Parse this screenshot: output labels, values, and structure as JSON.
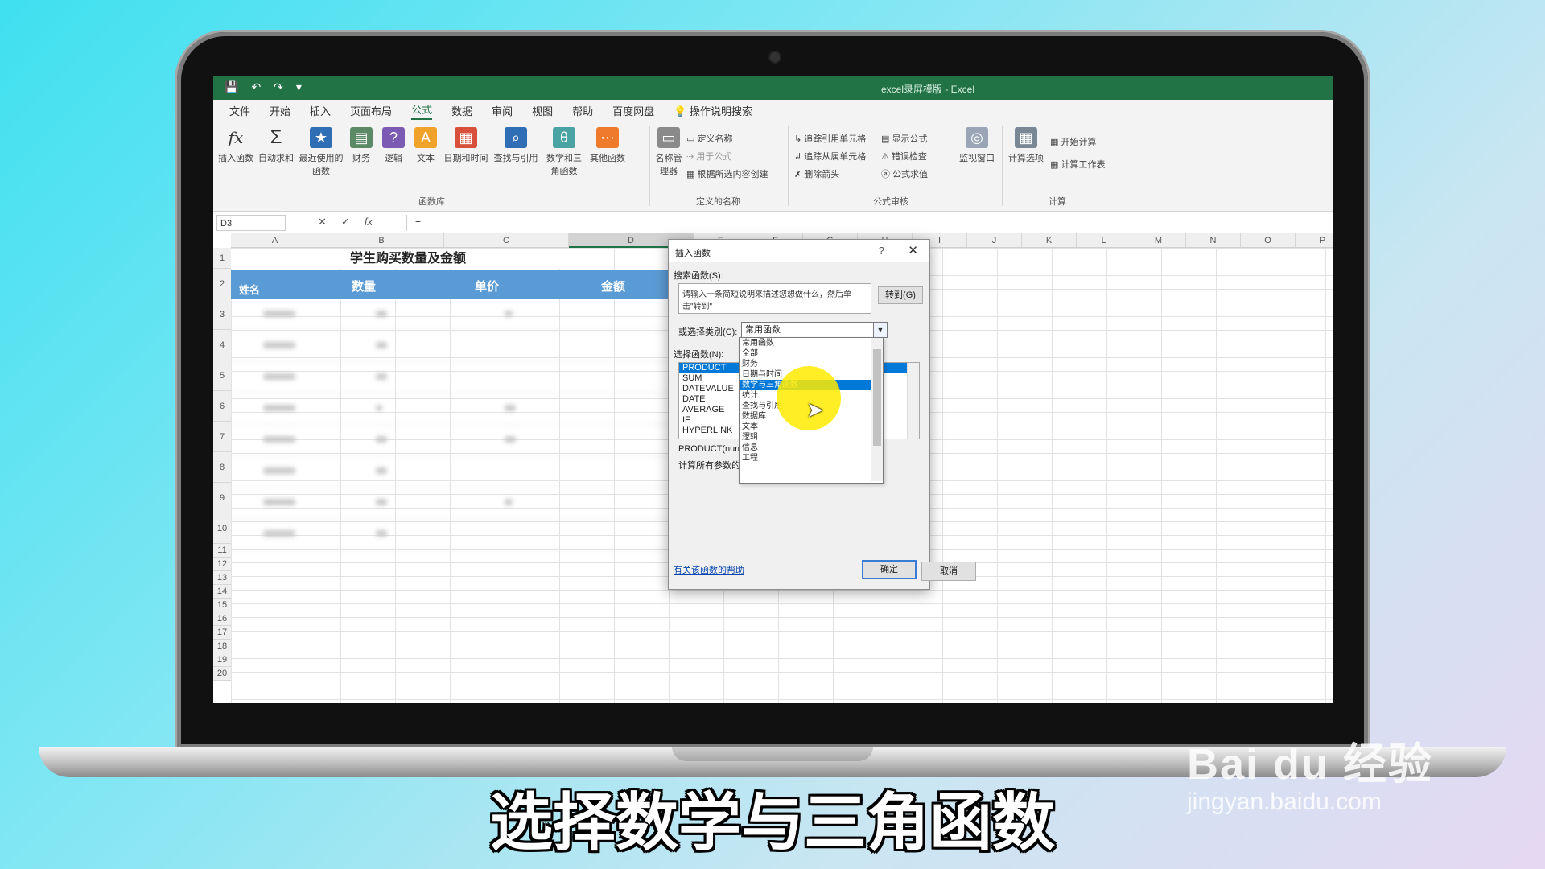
{
  "app": {
    "window_title": "excel录屏模版 - Excel"
  },
  "menu": [
    "文件",
    "开始",
    "插入",
    "页面布局",
    "公式",
    "数据",
    "审阅",
    "视图",
    "帮助",
    "百度网盘",
    "操作说明搜索"
  ],
  "active_menu_index": 4,
  "ribbon": {
    "big_buttons": [
      "插入函数",
      "自动求和",
      "最近使用的函数",
      "财务",
      "逻辑",
      "文本",
      "日期和时间",
      "查找与引用",
      "数学和三角函数",
      "其他函数",
      "名称管理器"
    ],
    "icons": [
      "fx-icon",
      "sigma-icon",
      "star-icon",
      "finance-icon",
      "logic-icon",
      "text-icon",
      "calendar-icon",
      "lookup-icon",
      "math-icon",
      "more-functions-icon",
      "name-manager-icon"
    ],
    "defined_names": [
      "定义名称",
      "用于公式",
      "根据所选内容创建"
    ],
    "audit": [
      "追踪引用单元格",
      "追踪从属单元格",
      "删除箭头",
      "显示公式",
      "错误检查",
      "公式求值"
    ],
    "watch": "监视窗口",
    "calc_options": "计算选项",
    "calc": [
      "开始计算",
      "计算工作表"
    ],
    "group_labels": [
      "函数库",
      "定义的名称",
      "公式审核",
      "计算"
    ]
  },
  "formula_bar": {
    "name_box": "D3",
    "formula": "="
  },
  "columns": [
    "A",
    "B",
    "C",
    "D",
    "E",
    "F",
    "G",
    "H",
    "I",
    "J",
    "K",
    "L",
    "M",
    "N",
    "O",
    "P"
  ],
  "rows": [
    "1",
    "2",
    "3",
    "4",
    "5",
    "6",
    "7",
    "8",
    "9",
    "10",
    "11",
    "12",
    "13",
    "14",
    "15",
    "16",
    "17",
    "18",
    "19",
    "20"
  ],
  "table": {
    "title": "学生购买数量及金额",
    "headers": [
      "姓名",
      "数量",
      "单价",
      "金额"
    ]
  },
  "dialog": {
    "title": "插入函数",
    "help_glyph": "?",
    "close_glyph": "✕",
    "search_label": "搜索函数(S):",
    "search_text": "请输入一条简短说明来描述您想做什么，然后单击\"转到\"",
    "go_button": "转到(G)",
    "category_label": "或选择类别(C):",
    "category_value": "常用函数",
    "select_label": "选择函数(N):",
    "functions": [
      "PRODUCT",
      "SUM",
      "DATEVALUE",
      "DATE",
      "AVERAGE",
      "IF",
      "HYPERLINK"
    ],
    "selected_function": 0,
    "signature": "PRODUCT(num",
    "description": "计算所有参数的",
    "help_link": "有关该函数的帮助",
    "ok_button": "确定",
    "cancel_button": "取消",
    "dropdown_options": [
      "常用函数",
      "全部",
      "财务",
      "日期与时间",
      "数学与三角函数",
      "统计",
      "查找与引用",
      "数据库",
      "文本",
      "逻辑",
      "信息",
      "工程"
    ],
    "dropdown_highlighted": 4
  },
  "caption": "选择数学与三角函数",
  "watermark": {
    "brand": "Bai du 经验",
    "url": "jingyan.baidu.com"
  }
}
